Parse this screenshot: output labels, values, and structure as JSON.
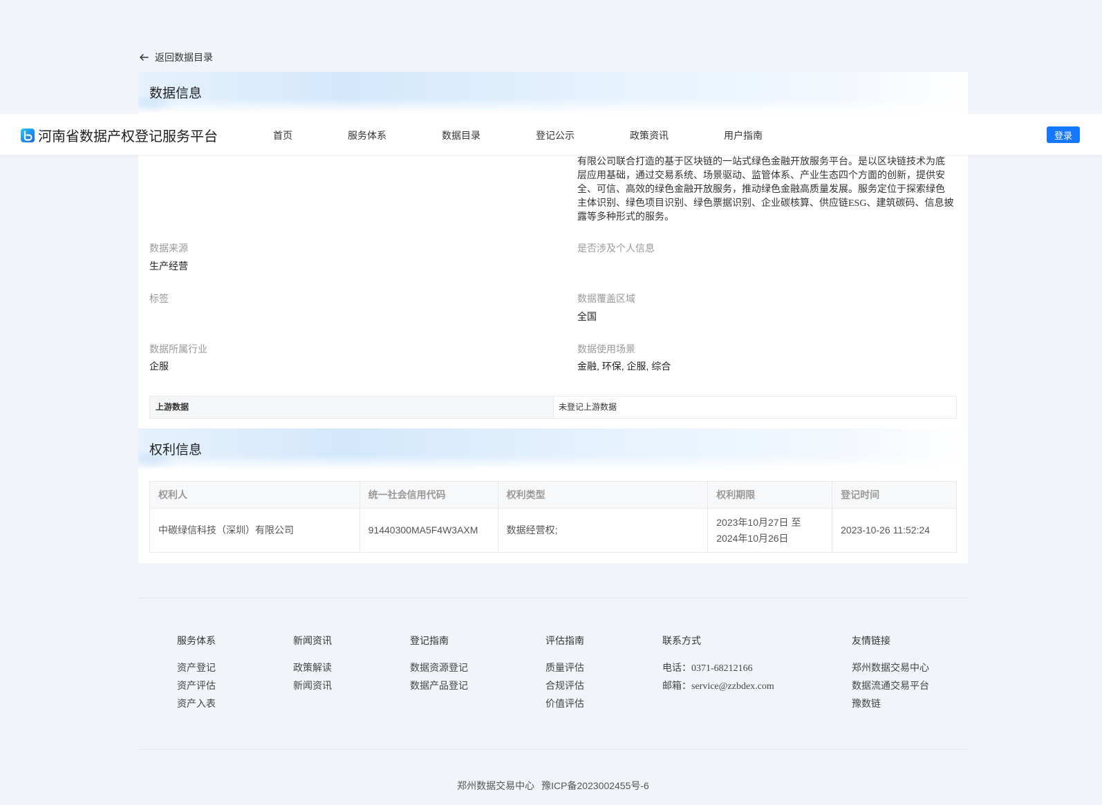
{
  "back_link": {
    "label": "返回数据目录"
  },
  "navbar": {
    "brand_title": "河南省数据产权登记服务平台",
    "items": [
      "首页",
      "服务体系",
      "数据目录",
      "登记公示",
      "政策资讯",
      "用户指南"
    ],
    "login_label": "登录"
  },
  "data_info": {
    "title": "数据信息",
    "description": "有限公司联合打造的基于区块链的一站式绿色金融开放服务平台。是以区块链技术为底层应用基础，通过交易系统、场景驱动、监管体系、产业生态四个方面的创新，提供安全、可信、高效的绿色金融开放服务，推动绿色金融高质量发展。服务定位于探索绿色主体识别、绿色项目识别、绿色票据识别、企业碳核算、供应链ESG、建筑碳码、信息披露等多种形式的服务。",
    "fields": [
      {
        "label": "数据来源",
        "value": "生产经营"
      },
      {
        "label": "是否涉及个人信息",
        "value": ""
      },
      {
        "label": "标签",
        "value": ""
      },
      {
        "label": "数据覆盖区域",
        "value": "全国"
      },
      {
        "label": "数据所属行业",
        "value": "企服"
      },
      {
        "label": "数据使用场景",
        "value": "金融, 环保, 企服, 综合"
      }
    ],
    "upstream": {
      "label": "上游数据",
      "value": "未登记上游数据"
    }
  },
  "rights_info": {
    "title": "权利信息",
    "columns": [
      "权利人",
      "统一社会信用代码",
      "权利类型",
      "权利期限",
      "登记时间"
    ],
    "rows": [
      {
        "holder": "中碳绿信科技（深圳）有限公司",
        "credit_code": "91440300MA5F4W3AXM",
        "right_type": "数据经营权;",
        "term_start": "2023年10月27日 至",
        "term_end": "2024年10月26日",
        "registered_at": "2023-10-26 11:52:24"
      }
    ]
  },
  "footer": {
    "columns": [
      {
        "title": "服务体系",
        "links": [
          "资产登记",
          "资产评估",
          "资产入表"
        ]
      },
      {
        "title": "新闻资讯",
        "links": [
          "政策解读",
          "新闻资讯"
        ]
      },
      {
        "title": "登记指南",
        "links": [
          "数据资源登记",
          "数据产品登记"
        ]
      },
      {
        "title": "评估指南",
        "links": [
          "质量评估",
          "合规评估",
          "价值评估"
        ]
      },
      {
        "title": "联系方式",
        "links": [
          "电话：0371-68212166",
          "邮箱：service@zzbdex.com"
        ]
      },
      {
        "title": "友情链接",
        "links": [
          "郑州数据交易中心",
          "数据流通交易平台",
          "豫数链"
        ]
      }
    ],
    "copyright": {
      "org": "郑州数据交易中心",
      "icp": "豫ICP备2023002455号-6"
    }
  },
  "colors": {
    "primary": "#1677ff",
    "background": "#f1f4f9"
  }
}
